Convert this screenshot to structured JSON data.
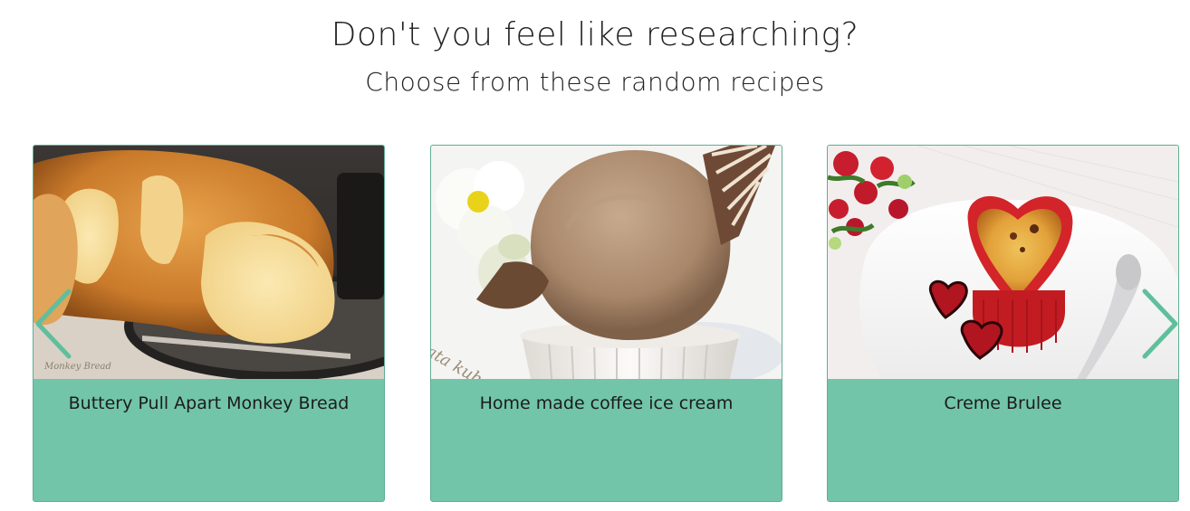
{
  "header": {
    "title": "Don't you feel like researching?",
    "subtitle": "Choose from these random recipes"
  },
  "carousel": {
    "prev_icon": "chevron-left-icon",
    "next_icon": "chevron-right-icon",
    "accent_color": "#72c5a8",
    "arrow_color": "#5fbf9c",
    "cards": [
      {
        "title": "Buttery Pull Apart Monkey Bread",
        "image_caption": "Monkey Bread"
      },
      {
        "title": "Home made coffee ice cream",
        "image_caption": "Lata kuhanja"
      },
      {
        "title": "Creme Brulee"
      }
    ]
  }
}
